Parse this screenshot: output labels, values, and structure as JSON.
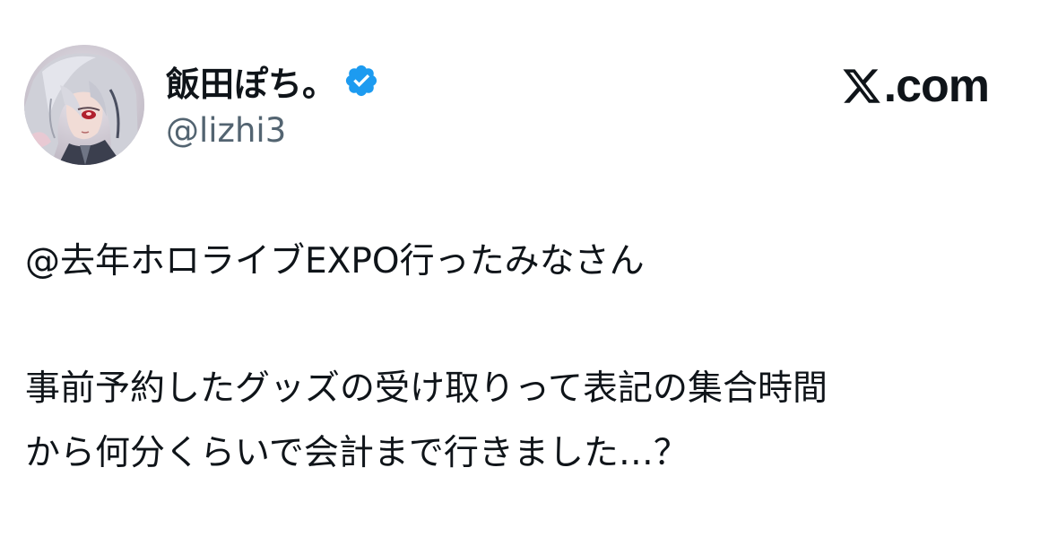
{
  "author": {
    "display_name": "飯田ぽち。",
    "handle": "@lizhi3",
    "verified": true,
    "verified_icon": "verified-badge-icon",
    "avatar_icon": "anime-character-avatar"
  },
  "brand": {
    "logo_icon": "x-logo-icon",
    "text": ".com"
  },
  "tweet": {
    "line_1": "@去年ホロライブEXPO行ったみなさん",
    "line_2": "事前予約したグッズの受け取りって表記の集合時間",
    "line_3": "から何分くらいで会計まで行きました…？"
  },
  "colors": {
    "text_primary": "#0f1419",
    "text_secondary": "#536471",
    "verified_blue": "#1d9bf0",
    "background": "#ffffff"
  }
}
